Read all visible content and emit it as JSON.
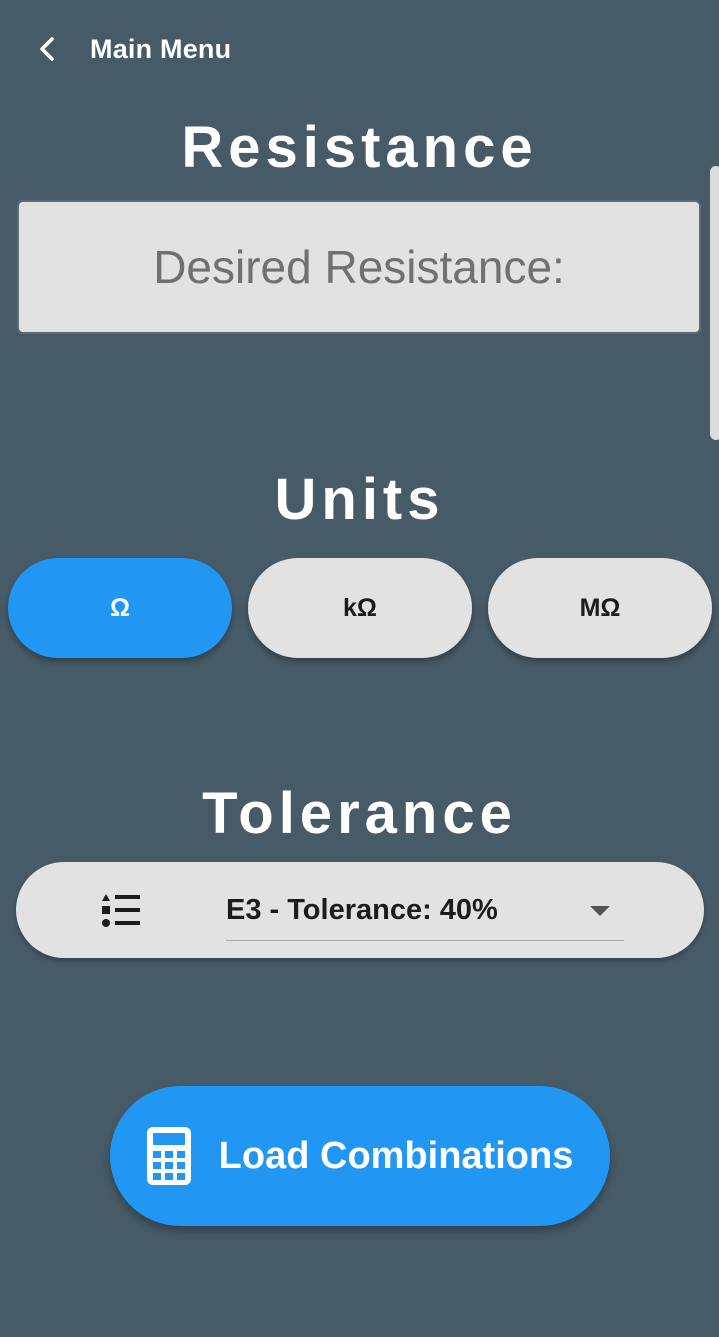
{
  "header": {
    "back_label": "Main Menu"
  },
  "resistance": {
    "title": "Resistance",
    "placeholder": "Desired Resistance:",
    "value": ""
  },
  "units": {
    "title": "Units",
    "options": [
      "Ω",
      "kΩ",
      "MΩ"
    ],
    "selected": "Ω"
  },
  "tolerance": {
    "title": "Tolerance",
    "selected": "E3 - Tolerance: 40%"
  },
  "actions": {
    "load_label": "Load Combinations"
  },
  "icons": {
    "back": "chevron-left-icon",
    "tolerance": "format-list-icon",
    "dropdown": "caret-down-icon",
    "load": "calculator-icon"
  },
  "colors": {
    "background": "#465a67",
    "accent": "#2196f3",
    "control_bg": "#e2e2e2",
    "text_light": "#ffffff",
    "text_dark": "#1c1c1c",
    "placeholder": "#707070"
  }
}
